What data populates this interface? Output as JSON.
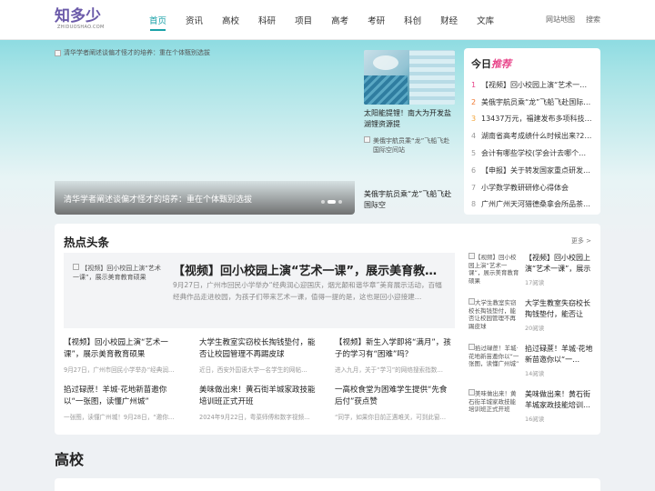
{
  "logo": {
    "cn": "知多少",
    "en": "ZHIDUOSHAO.COM"
  },
  "nav": [
    "首页",
    "资讯",
    "高校",
    "科研",
    "项目",
    "高考",
    "考研",
    "科创",
    "财经",
    "文库"
  ],
  "header_links": {
    "sitemap": "网站地图",
    "search": "搜索"
  },
  "slider": {
    "alt": "清华学者阐述谈偏才怪才的培养：重在个体甄别选拔",
    "caption": "清华学者阐述谈偏才怪才的培养：重在个体甄别选拔"
  },
  "side_news": [
    {
      "title": "太阳能提锂！南大为开发盐湖锂资源提"
    },
    {
      "alt": "美俄宇航员乘“龙”飞船飞赴国际空间站",
      "title": "美俄宇航员乘“龙”飞船飞赴国际空"
    }
  ],
  "today": {
    "title_a": "今日",
    "title_b": "推荐",
    "items": [
      "【视频】回小校园上演“艺术一…",
      "美俄宇航员乘“龙”飞船飞赴国际…",
      "13437万元，福建发布多项科技…",
      "湖南省高考成绩什么时候出来?2…",
      "会计有哪些学校(学会计去哪个…",
      "【申报】关于转发国家重点研发…",
      "小学数学教研研修心得体会",
      "广州广州天河猎德桑拿会所品茶…"
    ],
    "rank_colors": [
      "#e8468a",
      "#f0772f",
      "#f2a43a",
      "#999999",
      "#999999",
      "#999999",
      "#999999",
      "#999999"
    ]
  },
  "hot": {
    "title": "热点头条",
    "more": "更多 >",
    "feature": {
      "alt": "【视频】回小校园上演“艺术一课”，展示美育教育硕果",
      "title": "【视频】回小校园上演“艺术一课”，展示美育教育硕果",
      "desc": "9月27日，广州市回民小学举办“经典润心迎国庆，烟光颠和谐华章”美育展示活动，百幅经典作品走进校园，为孩子们带来艺术一课，值得一提的是，这也是回小迎接建…"
    },
    "cards": [
      {
        "title": "【视频】回小校园上演“艺术一课”，展示美育教育硕果",
        "desc": "9月27日，广州市回民小学举办“经典润…"
      },
      {
        "title": "大学生教室实窃校长掏钱垫付，能否让校园管理不再踢皮球",
        "desc": "近日，西安外国语大学一名学生的网帖…"
      },
      {
        "title": "【视频】新生入学即将“满月”，孩子的学习有“困难”吗？",
        "desc": "进入九月，关于“学习”的网络搜索指数…"
      },
      {
        "title": "掐过碌蔗！羊城·花地新苗邀你以“一张图，读懂广州城”",
        "desc": "一张图，读懂广州城！9月28日，“邀你…"
      },
      {
        "title": "美味做出来！黄石街羊城家政技能培训班正式开班",
        "desc": "2024年9月22日，粤菜师傅和数字视频…"
      },
      {
        "title": "一高校食堂为困难学生提供“先食后付”获点赞",
        "desc": "“同学，如果你目前正遇难关，可到此窗…"
      }
    ],
    "right_list": [
      {
        "alt": "【视频】回小校园上演“艺术一课”，展示美育教育硕果",
        "title": "【视频】回小校园上演“艺术一课”，展示",
        "views": "17阅读"
      },
      {
        "alt": "大学生教室实窃校长掏钱垫付，能否让校园管理不再踢皮球",
        "title": "大学生教室失窃校长掏钱垫付，能否让校…",
        "views": "20阅读"
      },
      {
        "alt": "掐过碌蔗！羊城·花地新苗邀你以“一张图，读懂广州城”",
        "title": "掐过碌蔗！羊城·花地新苗邀你以“一…",
        "views": "14阅读"
      },
      {
        "alt": "美味做出来！黄石街羊城家政技能培训班正式开班",
        "title": "美味做出来！黄石街羊城家政技能培训…",
        "views": "16阅读"
      }
    ]
  },
  "section2": {
    "title": "高校"
  }
}
